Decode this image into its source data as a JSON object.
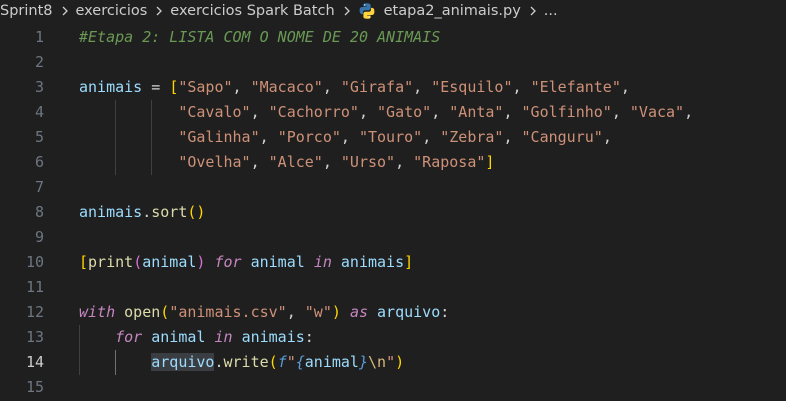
{
  "breadcrumb": {
    "items": [
      "Sprint8",
      "exercicios",
      "exercicios Spark Batch"
    ],
    "file": "etapa2_animais.py",
    "more": "..."
  },
  "editor": {
    "active_line": 14,
    "line_numbers": [
      "1",
      "2",
      "3",
      "4",
      "5",
      "6",
      "7",
      "8",
      "9",
      "10",
      "11",
      "12",
      "13",
      "14",
      "15"
    ],
    "lines": [
      [
        {
          "t": "#Etapa 2: LISTA COM O NOME DE 20 ANIMAIS",
          "c": "c-comment"
        }
      ],
      [],
      [
        {
          "t": "animais",
          "c": "c-var"
        },
        {
          "t": " = ",
          "c": "c-op"
        },
        {
          "t": "[",
          "c": "c-br1"
        },
        {
          "t": "\"Sapo\"",
          "c": "c-str"
        },
        {
          "t": ", ",
          "c": "c-plain"
        },
        {
          "t": "\"Macaco\"",
          "c": "c-str"
        },
        {
          "t": ", ",
          "c": "c-plain"
        },
        {
          "t": "\"Girafa\"",
          "c": "c-str"
        },
        {
          "t": ", ",
          "c": "c-plain"
        },
        {
          "t": "\"Esquilo\"",
          "c": "c-str"
        },
        {
          "t": ", ",
          "c": "c-plain"
        },
        {
          "t": "\"Elefante\"",
          "c": "c-str"
        },
        {
          "t": ",",
          "c": "c-plain"
        }
      ],
      [
        {
          "t": "           ",
          "c": "c-plain"
        },
        {
          "t": "\"Cavalo\"",
          "c": "c-str"
        },
        {
          "t": ", ",
          "c": "c-plain"
        },
        {
          "t": "\"Cachorro\"",
          "c": "c-str"
        },
        {
          "t": ", ",
          "c": "c-plain"
        },
        {
          "t": "\"Gato\"",
          "c": "c-str"
        },
        {
          "t": ", ",
          "c": "c-plain"
        },
        {
          "t": "\"Anta\"",
          "c": "c-str"
        },
        {
          "t": ", ",
          "c": "c-plain"
        },
        {
          "t": "\"Golfinho\"",
          "c": "c-str"
        },
        {
          "t": ", ",
          "c": "c-plain"
        },
        {
          "t": "\"Vaca\"",
          "c": "c-str"
        },
        {
          "t": ",",
          "c": "c-plain"
        }
      ],
      [
        {
          "t": "           ",
          "c": "c-plain"
        },
        {
          "t": "\"Galinha\"",
          "c": "c-str"
        },
        {
          "t": ", ",
          "c": "c-plain"
        },
        {
          "t": "\"Porco\"",
          "c": "c-str"
        },
        {
          "t": ", ",
          "c": "c-plain"
        },
        {
          "t": "\"Touro\"",
          "c": "c-str"
        },
        {
          "t": ", ",
          "c": "c-plain"
        },
        {
          "t": "\"Zebra\"",
          "c": "c-str"
        },
        {
          "t": ", ",
          "c": "c-plain"
        },
        {
          "t": "\"Canguru\"",
          "c": "c-str"
        },
        {
          "t": ",",
          "c": "c-plain"
        }
      ],
      [
        {
          "t": "           ",
          "c": "c-plain"
        },
        {
          "t": "\"Ovelha\"",
          "c": "c-str"
        },
        {
          "t": ", ",
          "c": "c-plain"
        },
        {
          "t": "\"Alce\"",
          "c": "c-str"
        },
        {
          "t": ", ",
          "c": "c-plain"
        },
        {
          "t": "\"Urso\"",
          "c": "c-str"
        },
        {
          "t": ", ",
          "c": "c-plain"
        },
        {
          "t": "\"Raposa\"",
          "c": "c-str"
        },
        {
          "t": "]",
          "c": "c-br1"
        }
      ],
      [],
      [
        {
          "t": "animais",
          "c": "c-var"
        },
        {
          "t": ".",
          "c": "c-plain"
        },
        {
          "t": "sort",
          "c": "c-func"
        },
        {
          "t": "()",
          "c": "c-br1"
        }
      ],
      [],
      [
        {
          "t": "[",
          "c": "c-br1"
        },
        {
          "t": "print",
          "c": "c-builtin"
        },
        {
          "t": "(",
          "c": "c-br2"
        },
        {
          "t": "animal",
          "c": "c-var"
        },
        {
          "t": ")",
          "c": "c-br2"
        },
        {
          "t": " ",
          "c": "c-plain"
        },
        {
          "t": "for",
          "c": "c-kwflow"
        },
        {
          "t": " ",
          "c": "c-plain"
        },
        {
          "t": "animal",
          "c": "c-var"
        },
        {
          "t": " ",
          "c": "c-plain"
        },
        {
          "t": "in",
          "c": "c-kwflow"
        },
        {
          "t": " ",
          "c": "c-plain"
        },
        {
          "t": "animais",
          "c": "c-var"
        },
        {
          "t": "]",
          "c": "c-br1"
        }
      ],
      [],
      [
        {
          "t": "with",
          "c": "c-kwflow"
        },
        {
          "t": " ",
          "c": "c-plain"
        },
        {
          "t": "open",
          "c": "c-builtin"
        },
        {
          "t": "(",
          "c": "c-br1"
        },
        {
          "t": "\"animais.csv\"",
          "c": "c-str"
        },
        {
          "t": ", ",
          "c": "c-plain"
        },
        {
          "t": "\"w\"",
          "c": "c-str"
        },
        {
          "t": ")",
          "c": "c-br1"
        },
        {
          "t": " ",
          "c": "c-plain"
        },
        {
          "t": "as",
          "c": "c-kwflow"
        },
        {
          "t": " ",
          "c": "c-plain"
        },
        {
          "t": "arquivo",
          "c": "c-var"
        },
        {
          "t": ":",
          "c": "c-plain"
        }
      ],
      [
        {
          "t": "    ",
          "c": "c-plain"
        },
        {
          "t": "for",
          "c": "c-kwflow"
        },
        {
          "t": " ",
          "c": "c-plain"
        },
        {
          "t": "animal",
          "c": "c-var"
        },
        {
          "t": " ",
          "c": "c-plain"
        },
        {
          "t": "in",
          "c": "c-kwflow"
        },
        {
          "t": " ",
          "c": "c-plain"
        },
        {
          "t": "animais",
          "c": "c-var"
        },
        {
          "t": ":",
          "c": "c-plain"
        }
      ],
      [
        {
          "t": "        ",
          "c": "c-plain"
        },
        {
          "t": "arquivo",
          "c": "c-var sel-word"
        },
        {
          "t": ".",
          "c": "c-plain"
        },
        {
          "t": "write",
          "c": "c-func"
        },
        {
          "t": "(",
          "c": "c-br1"
        },
        {
          "t": "f",
          "c": "c-fpre"
        },
        {
          "t": "\"",
          "c": "c-str"
        },
        {
          "t": "{",
          "c": "c-kw"
        },
        {
          "t": "animal",
          "c": "c-var"
        },
        {
          "t": "}",
          "c": "c-kw"
        },
        {
          "t": "\\n",
          "c": "c-esc"
        },
        {
          "t": "\"",
          "c": "c-str"
        },
        {
          "t": ")",
          "c": "c-br1"
        }
      ],
      []
    ]
  }
}
